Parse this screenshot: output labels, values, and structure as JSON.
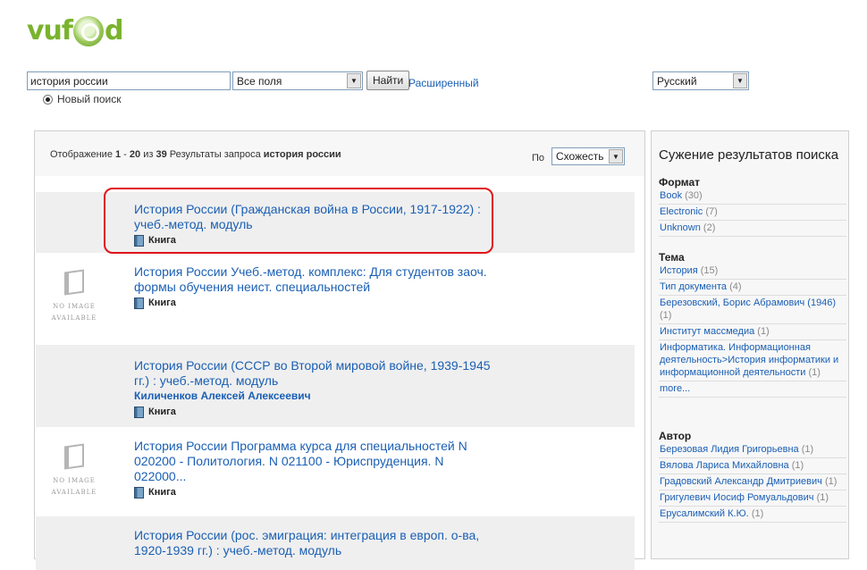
{
  "header": {
    "logo_text": "vufind"
  },
  "search": {
    "query": "история россии",
    "field_select": "Все поля",
    "submit_label": "Найти",
    "advanced_link": "Расширенный",
    "new_search_label": "Новый поиск",
    "language_select": "Русский"
  },
  "results": {
    "summary": {
      "prefix": "Отображение ",
      "from": "1",
      "dash": " - ",
      "to": "20",
      "of": " из ",
      "total": "39",
      "middle": " Результаты запроса ",
      "query": "история россии"
    },
    "sort_label": "По",
    "sort_value": "Схожесть",
    "no_image_line1": "NO IMAGE",
    "no_image_line2": "AVAILABLE",
    "items": [
      {
        "title": "История России (Гражданская война в России, 1917-1922) : учеб.-метод. модуль",
        "author": "",
        "format": "Книга"
      },
      {
        "title": "История России Учеб.-метод. комплекс: Для студентов заоч. формы обучения неист. специальностей",
        "author": "",
        "format": "Книга"
      },
      {
        "title": "История России (СССР во Второй мировой войне, 1939-1945 гг.) : учеб.-метод. модуль",
        "author": "Киличенков Алексей Алексеевич",
        "format": "Книга"
      },
      {
        "title": "История России Программа курса для специальностей N 020200 - Политология. N 021100 - Юриспруденция. N 022000...",
        "author": "",
        "format": "Книга"
      },
      {
        "title": "История России (рос. эмиграция: интеграция в европ. о-ва, 1920-1939 гг.) : учеб.-метод. модуль",
        "author": "",
        "format": ""
      }
    ]
  },
  "sidebar": {
    "title": "Сужение результатов поиска",
    "groups": [
      {
        "heading": "Формат",
        "items": [
          {
            "label": "Book",
            "count": "(30)"
          },
          {
            "label": "Electronic",
            "count": "(7)"
          },
          {
            "label": "Unknown",
            "count": "(2)"
          }
        ]
      },
      {
        "heading": "Тема",
        "items": [
          {
            "label": "История",
            "count": "(15)"
          },
          {
            "label": "Тип документа",
            "count": "(4)"
          },
          {
            "label": "Березовский, Борис Абрамович (1946)",
            "count": "(1)"
          },
          {
            "label": "Институт массмедиа",
            "count": "(1)"
          },
          {
            "label": "Информатика. Информационная деятельность>История информатики и информационной деятельности",
            "count": "(1)"
          },
          {
            "label": "more...",
            "count": ""
          }
        ]
      },
      {
        "heading": "Автор",
        "items": [
          {
            "label": "Березовая Лидия Григорьевна",
            "count": "(1)"
          },
          {
            "label": "Вялова Лариса Михайловна",
            "count": "(1)"
          },
          {
            "label": "Градовский Александр Дмитриевич",
            "count": "(1)"
          },
          {
            "label": "Григулевич Иосиф Ромуальдович",
            "count": "(1)"
          },
          {
            "label": "Ерусалимский К.Ю.",
            "count": "(1)"
          }
        ]
      }
    ]
  },
  "colors": {
    "link": "#2f6fba",
    "highlight_border": "#e0141a",
    "logo_green": "#7ab32e"
  }
}
